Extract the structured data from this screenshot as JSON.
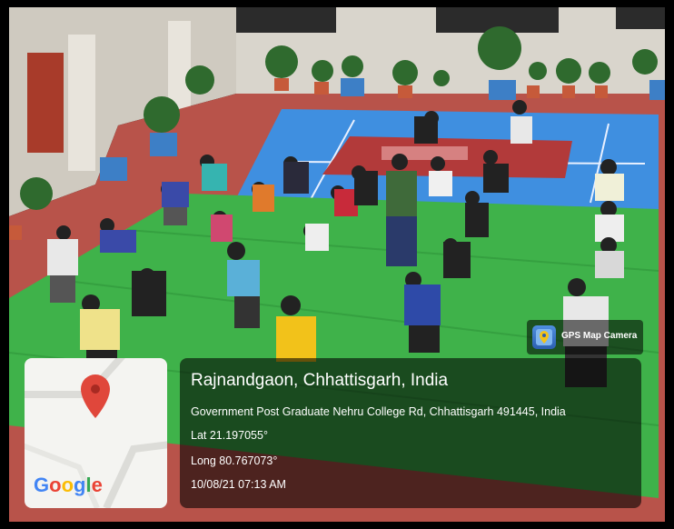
{
  "stamp": {
    "app_name": "GPS Map Camera",
    "location_title": "Rajnandgaon, Chhattisgarh, India",
    "address": "Government Post Graduate Nehru College Rd, Chhattisgarh 491445, India",
    "latitude": "Lat 21.197055°",
    "longitude": "Long 80.767073°",
    "datetime": "10/08/21 07:13 AM",
    "map_provider": "Google"
  },
  "colors": {
    "court_blue": "#3f8fe0",
    "mat_green": "#3fb24a",
    "brick_red": "#b8534a",
    "map_pin": "#e0473b"
  }
}
